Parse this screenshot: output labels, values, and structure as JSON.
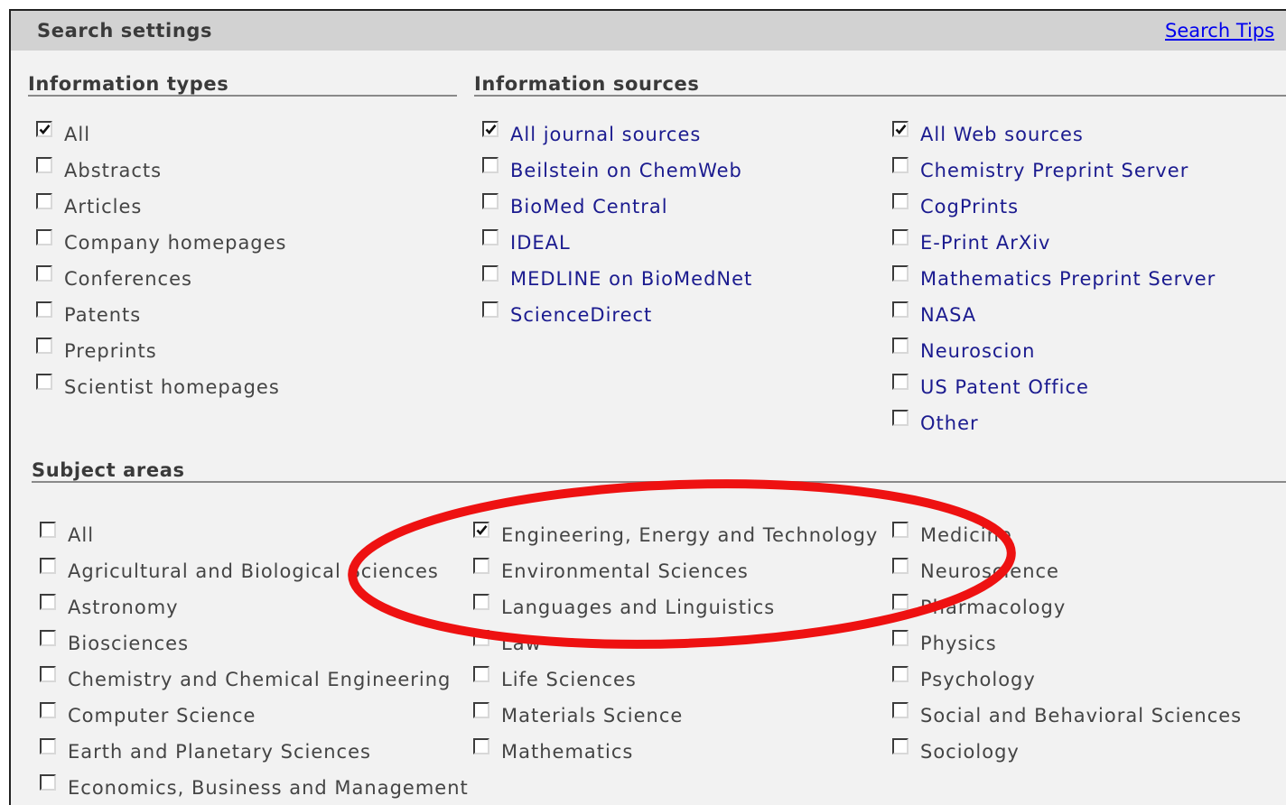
{
  "header": {
    "title": "Search settings",
    "tips_link": "Search Tips"
  },
  "info_types": {
    "title": "Information types",
    "items": [
      {
        "label": "All",
        "checked": true
      },
      {
        "label": "Abstracts",
        "checked": false
      },
      {
        "label": "Articles",
        "checked": false
      },
      {
        "label": "Company homepages",
        "checked": false
      },
      {
        "label": "Conferences",
        "checked": false
      },
      {
        "label": "Patents",
        "checked": false
      },
      {
        "label": "Preprints",
        "checked": false
      },
      {
        "label": "Scientist homepages",
        "checked": false
      }
    ]
  },
  "info_sources": {
    "title": "Information sources",
    "journal": [
      {
        "label": "All journal sources",
        "checked": true
      },
      {
        "label": "Beilstein on ChemWeb",
        "checked": false
      },
      {
        "label": "BioMed Central",
        "checked": false
      },
      {
        "label": "IDEAL",
        "checked": false
      },
      {
        "label": "MEDLINE on BioMedNet",
        "checked": false
      },
      {
        "label": "ScienceDirect",
        "checked": false
      }
    ],
    "web": [
      {
        "label": "All Web sources",
        "checked": true
      },
      {
        "label": "Chemistry Preprint Server",
        "checked": false
      },
      {
        "label": "CogPrints",
        "checked": false
      },
      {
        "label": "E-Print ArXiv",
        "checked": false
      },
      {
        "label": "Mathematics Preprint Server",
        "checked": false
      },
      {
        "label": "NASA",
        "checked": false
      },
      {
        "label": "Neuroscion",
        "checked": false
      },
      {
        "label": "US Patent Office",
        "checked": false
      },
      {
        "label": "Other",
        "checked": false
      }
    ]
  },
  "subjects": {
    "title": "Subject areas",
    "col1": [
      {
        "label": "All",
        "checked": false
      },
      {
        "label": "Agricultural and Biological Sciences",
        "checked": false
      },
      {
        "label": "Astronomy",
        "checked": false
      },
      {
        "label": "Biosciences",
        "checked": false
      },
      {
        "label": "Chemistry and Chemical Engineering",
        "checked": false
      },
      {
        "label": "Computer Science",
        "checked": false
      },
      {
        "label": "Earth and Planetary Sciences",
        "checked": false
      },
      {
        "label": "Economics, Business and Management",
        "checked": false
      }
    ],
    "col2": [
      {
        "label": "Engineering, Energy and Technology",
        "checked": true
      },
      {
        "label": "Environmental Sciences",
        "checked": false
      },
      {
        "label": "Languages and Linguistics",
        "checked": false
      },
      {
        "label": "Law",
        "checked": false
      },
      {
        "label": "Life Sciences",
        "checked": false
      },
      {
        "label": "Materials Science",
        "checked": false
      },
      {
        "label": "Mathematics",
        "checked": false
      }
    ],
    "col3": [
      {
        "label": "Medicine",
        "checked": false
      },
      {
        "label": "Neuroscience",
        "checked": false
      },
      {
        "label": "Pharmacology",
        "checked": false
      },
      {
        "label": "Physics",
        "checked": false
      },
      {
        "label": "Psychology",
        "checked": false
      },
      {
        "label": "Social and Behavioral Sciences",
        "checked": false
      },
      {
        "label": "Sociology",
        "checked": false
      }
    ]
  },
  "annotation": {
    "shape": "ellipse",
    "color": "#ee1111",
    "target": "Engineering, Energy and Technology"
  }
}
